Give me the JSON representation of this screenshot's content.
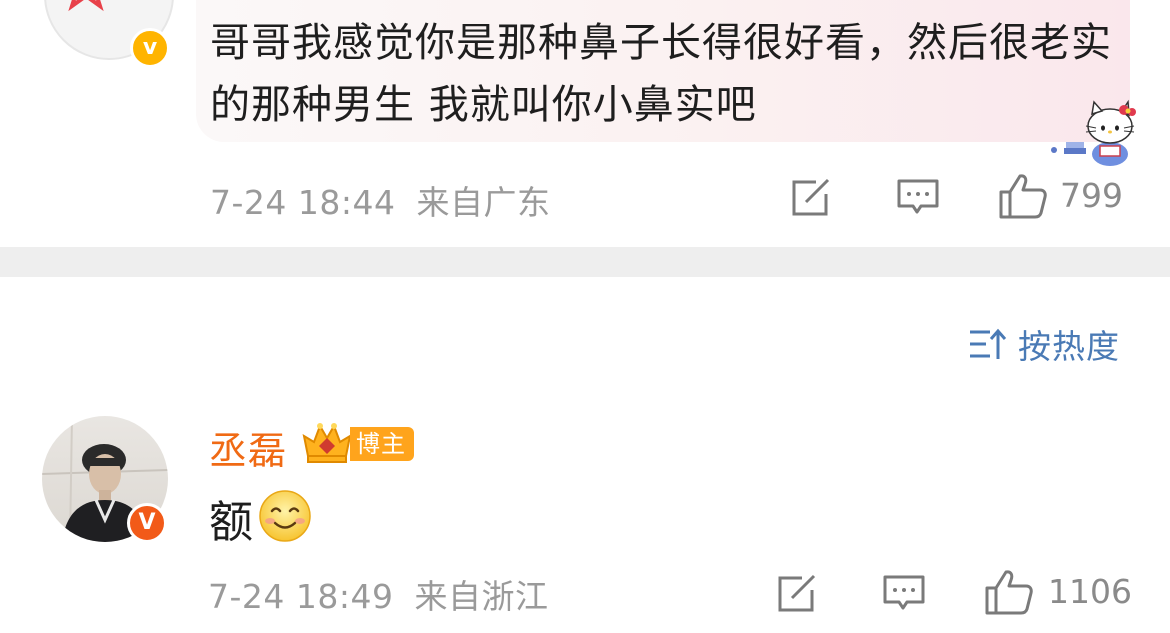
{
  "comments": [
    {
      "text": "哥哥我感觉你是那种鼻子长得很好看，然后很老实的那种男生 我就叫你小鼻实吧",
      "verified_mark": "v",
      "date": "7-24 18:44",
      "location": "来自广东",
      "likes": "799",
      "icons": {
        "share": "share-icon",
        "reply": "comment-icon",
        "like": "thumb-up-icon",
        "decoration": "hello-kitty-sticker"
      }
    },
    {
      "username": "丞磊",
      "badge_label": "博主",
      "verified_mark": "V",
      "text": "额",
      "emoji": "smile-emoji",
      "date": "7-24 18:49",
      "location": "来自浙江",
      "likes": "1106",
      "icons": {
        "share": "share-icon",
        "reply": "comment-icon",
        "like": "thumb-up-icon"
      }
    }
  ],
  "sort": {
    "label": "按热度",
    "icon": "sort-icon"
  },
  "colors": {
    "username": "#f06a14",
    "sort_blue": "#4a7ab5",
    "badge_orange": "#ffa41c",
    "verified_yellow": "#ffb400",
    "verified_orange": "#f25a18",
    "meta_gray": "#9a9a9a",
    "divider": "#eeeeee"
  }
}
